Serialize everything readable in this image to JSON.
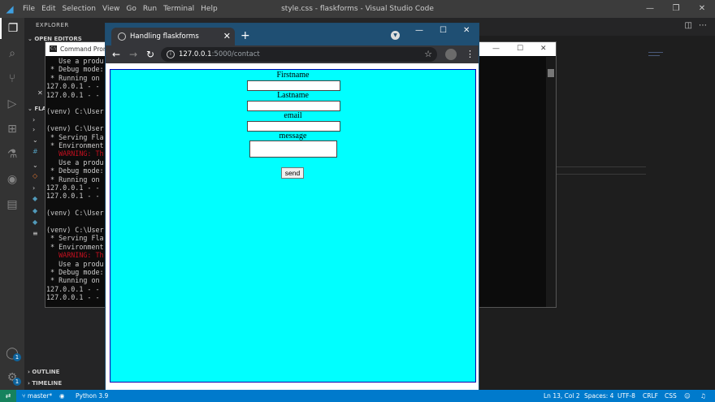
{
  "vscode": {
    "menu": [
      "File",
      "Edit",
      "Selection",
      "View",
      "Go",
      "Run",
      "Terminal",
      "Help"
    ],
    "window_title": "style.css - flaskforms - Visual Studio Code",
    "sidebar": {
      "title": "EXPLORER",
      "open_editors": "OPEN EDITORS",
      "folder": "FLA",
      "outline": "OUTLINE",
      "timeline": "TIMELINE"
    },
    "accounts_badge": "1",
    "settings_badge": "1"
  },
  "status": {
    "branch": "master*",
    "python": "Python 3.9",
    "position": "Ln 13, Col 2",
    "spaces": "Spaces: 4",
    "encoding": "UTF-8",
    "eol": "CRLF",
    "language": "CSS"
  },
  "cmd": {
    "title": "Command Prom",
    "lines": [
      "   Use a produ",
      " * Debug mode:",
      " * Running on",
      "127.0.0.1 - -",
      "127.0.0.1 - -",
      "",
      "(venv) C:\\User",
      "",
      "(venv) C:\\User",
      " * Serving Fla",
      " * Environment",
      "   WARNING: Th",
      "   Use a produ",
      " * Debug mode:",
      " * Running on",
      "127.0.0.1 - -",
      "127.0.0.1 - -",
      "",
      "(venv) C:\\User",
      "",
      "(venv) C:\\User",
      " * Serving Fla",
      " * Environment",
      "   WARNING: Th",
      "   Use a produ",
      " * Debug mode:",
      " * Running on",
      "127.0.0.1 - -",
      "127.0.0.1 - -"
    ],
    "warning_rows": [
      11,
      23
    ]
  },
  "chrome": {
    "tab_title": "Handling flaskforms",
    "url_host": "127.0.0.1",
    "url_rest": ":5000/contact"
  },
  "form": {
    "firstname_label": "Firstname",
    "lastname_label": "Lastname",
    "email_label": "email",
    "message_label": "message",
    "submit_label": "send"
  }
}
